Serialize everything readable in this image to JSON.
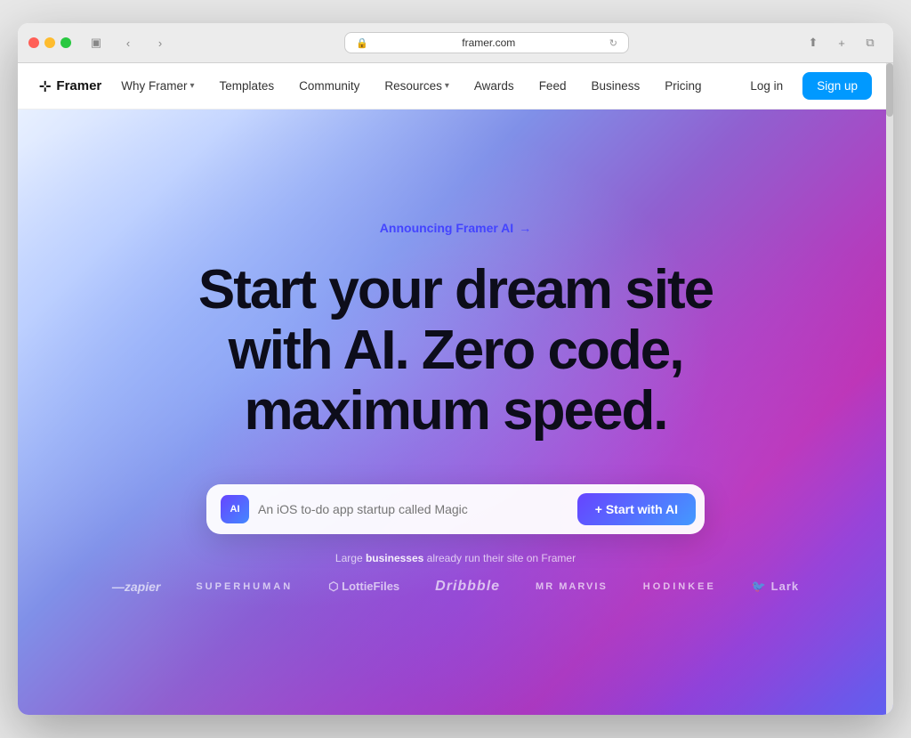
{
  "browser": {
    "url": "framer.com",
    "refresh_icon": "↺",
    "back_icon": "‹",
    "forward_icon": "›",
    "share_icon": "⬆",
    "new_tab_icon": "+",
    "copy_icon": "⧉",
    "window_icon": "▣"
  },
  "navbar": {
    "logo_text": "Framer",
    "logo_icon": "⊹",
    "links": [
      {
        "label": "Why Framer",
        "has_dropdown": true
      },
      {
        "label": "Templates",
        "has_dropdown": false
      },
      {
        "label": "Community",
        "has_dropdown": false
      },
      {
        "label": "Resources",
        "has_dropdown": true
      },
      {
        "label": "Awards",
        "has_dropdown": false
      },
      {
        "label": "Feed",
        "has_dropdown": false
      },
      {
        "label": "Business",
        "has_dropdown": false
      },
      {
        "label": "Pricing",
        "has_dropdown": false
      }
    ],
    "login_label": "Log in",
    "signup_label": "Sign up"
  },
  "hero": {
    "announce_text": "Announcing Framer AI",
    "announce_arrow": "→",
    "title_line1": "Start your dream site",
    "title_line2": "with AI. Zero code,",
    "title_line3": "maximum speed.",
    "ai_badge_text": "AI",
    "input_placeholder": "An iOS to-do app startup called Magic",
    "cta_label": "+ Start with AI"
  },
  "logos": {
    "label_normal": "Large ",
    "label_bold": "businesses",
    "label_rest": " already run their site on Framer",
    "items": [
      {
        "name": "zapier",
        "text": "—zapier",
        "style": "zapier"
      },
      {
        "name": "superhuman",
        "text": "SUPERHUMAN",
        "style": "superhuman"
      },
      {
        "name": "lottiefiles",
        "text": "⬡ LottieFiles",
        "style": "lottie"
      },
      {
        "name": "dribbble",
        "text": "Dribbble",
        "style": "dribbble"
      },
      {
        "name": "mrmarvis",
        "text": "MR MARVIS",
        "style": "mrmarvis"
      },
      {
        "name": "hodinkee",
        "text": "HODINKEE",
        "style": "hodinkee"
      },
      {
        "name": "lark",
        "text": "🐦 Lark",
        "style": "lark"
      }
    ]
  }
}
